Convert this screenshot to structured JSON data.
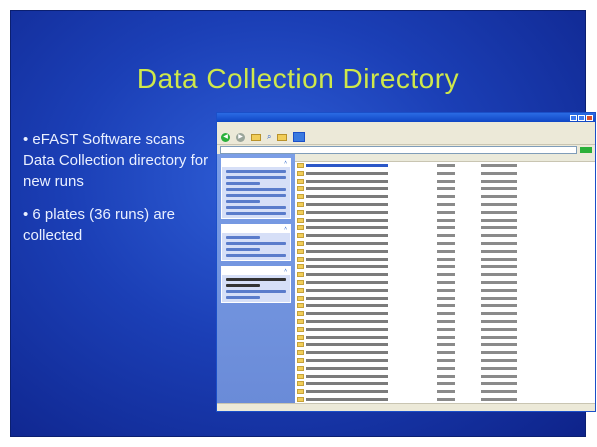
{
  "slide": {
    "title": "Data Collection Directory",
    "bullets": [
      "• eFAST Software scans Data Collection directory for new runs",
      "• 6 plates (36 runs) are collected"
    ]
  },
  "explorer": {
    "row_count": 36
  }
}
